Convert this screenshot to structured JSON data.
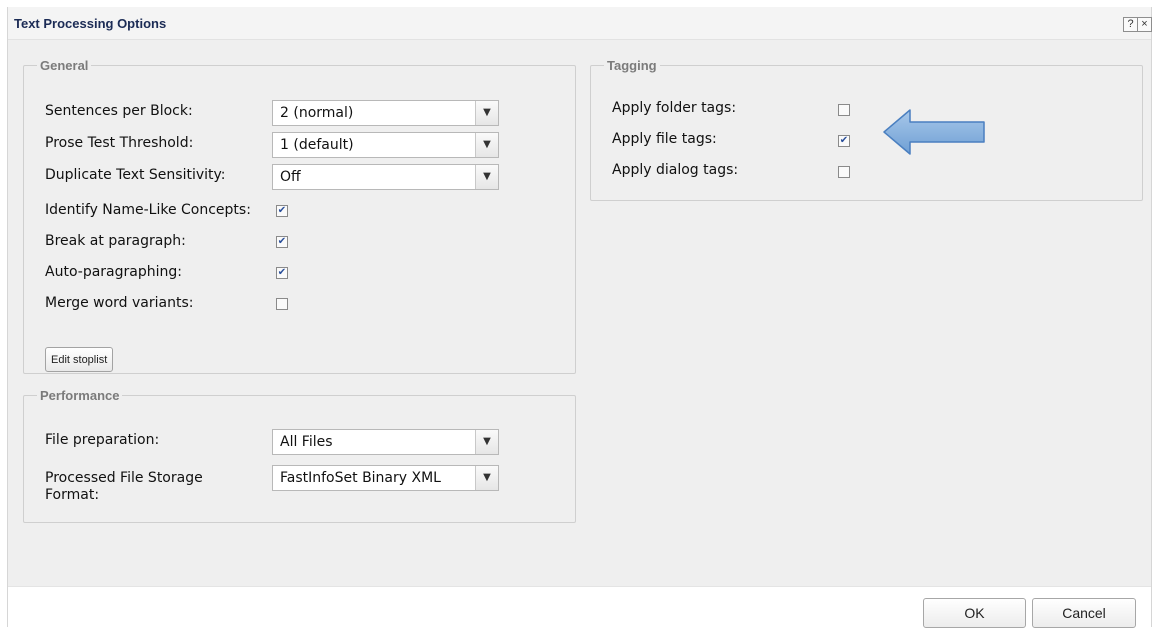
{
  "dialog": {
    "title": "Text Processing Options",
    "help_label": "?",
    "close_label": "×"
  },
  "general": {
    "legend": "General",
    "rows": [
      {
        "label": "Sentences per Block:",
        "value": "2 (normal)"
      },
      {
        "label": "Prose Test Threshold:",
        "value": "1 (default)"
      },
      {
        "label": "Duplicate Text Sensitivity:",
        "value": "Off"
      }
    ],
    "checks": [
      {
        "label": "Identify Name-Like Concepts:",
        "checked": true
      },
      {
        "label": "Break at paragraph:",
        "checked": true
      },
      {
        "label": "Auto-paragraphing:",
        "checked": true
      },
      {
        "label": "Merge word variants:",
        "checked": false
      }
    ],
    "edit_stoplist_label": "Edit stoplist"
  },
  "performance": {
    "legend": "Performance",
    "file_preparation_label": "File preparation:",
    "file_preparation_value": "All Files",
    "storage_label_line1": "Processed File Storage",
    "storage_label_line2": "Format:",
    "storage_value": "FastInfoSet Binary XML"
  },
  "tagging": {
    "legend": "Tagging",
    "checks": [
      {
        "label": "Apply folder tags:",
        "checked": false
      },
      {
        "label": "Apply file tags:",
        "checked": true
      },
      {
        "label": "Apply dialog tags:",
        "checked": false
      }
    ]
  },
  "footer": {
    "ok_label": "OK",
    "cancel_label": "Cancel"
  },
  "icons": {
    "dropdown": "chevron-down-icon",
    "check": "checkmark-icon",
    "annotation": "left-arrow-icon"
  },
  "colors": {
    "title_text": "#1b2b55",
    "legend_text": "#7b7b7b",
    "arrow_fill": "#7aa7d8",
    "arrow_stroke": "#4a7fc0",
    "check_color": "#2a4f9a"
  }
}
